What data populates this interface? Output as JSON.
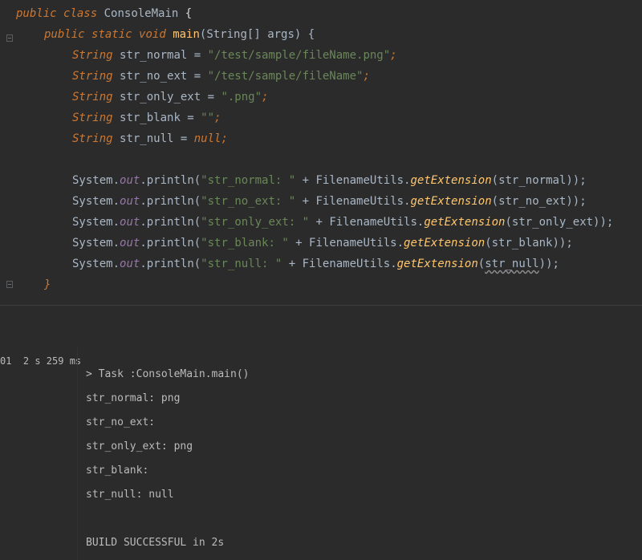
{
  "editor": {
    "lines": {
      "l1": {
        "kw1": "public",
        "kw2": "class",
        "name": "ConsoleMain",
        "brace": "{"
      },
      "l2": {
        "kw1": "public",
        "kw2": "static",
        "kw3": "void",
        "method": "main",
        "params": "(String[] args) {"
      },
      "l3": {
        "type": "String",
        "decl": "str_normal = ",
        "str": "\"/test/sample/fileName.png\"",
        "end": ";"
      },
      "l4": {
        "type": "String",
        "decl": "str_no_ext = ",
        "str": "\"/test/sample/fileName\"",
        "end": ";"
      },
      "l5": {
        "type": "String",
        "decl": "str_only_ext = ",
        "str": "\".png\"",
        "end": ";"
      },
      "l6": {
        "type": "String",
        "decl": "str_blank = ",
        "str": "\"\"",
        "end": ";"
      },
      "l7": {
        "type": "String",
        "decl": "str_null = ",
        "nullkw": "null",
        "end": ";"
      },
      "p1": {
        "sys": "System.",
        "out": "out",
        "call": ".println(",
        "str": "\"str_normal: \"",
        "plus": " + FilenameUtils.",
        "get": "getExtension",
        "arg": "(str_normal));"
      },
      "p2": {
        "sys": "System.",
        "out": "out",
        "call": ".println(",
        "str": "\"str_no_ext: \"",
        "plus": " + FilenameUtils.",
        "get": "getExtension",
        "arg": "(str_no_ext));"
      },
      "p3": {
        "sys": "System.",
        "out": "out",
        "call": ".println(",
        "str": "\"str_only_ext: \"",
        "plus": " + FilenameUtils.",
        "get": "getExtension",
        "arg": "(str_only_ext));"
      },
      "p4": {
        "sys": "System.",
        "out": "out",
        "call": ".println(",
        "str": "\"str_blank: \"",
        "plus": " + FilenameUtils.",
        "get": "getExtension",
        "arg": "(str_blank));"
      },
      "p5": {
        "sys": "System.",
        "out": "out",
        "call": ".println(",
        "str": "\"str_null: \"",
        "plus": " + FilenameUtils.",
        "get": "getExtension",
        "arg_open": "(",
        "arg_warn": "str_null",
        "arg_close": "));"
      },
      "close_method": "}"
    }
  },
  "console": {
    "run_time": "01  2 s 259 ms",
    "output": [
      "> Task :ConsoleMain.main()",
      "str_normal: png",
      "str_no_ext:",
      "str_only_ext: png",
      "str_blank:",
      "str_null: null",
      "BUILD SUCCESSFUL in 2s"
    ]
  }
}
